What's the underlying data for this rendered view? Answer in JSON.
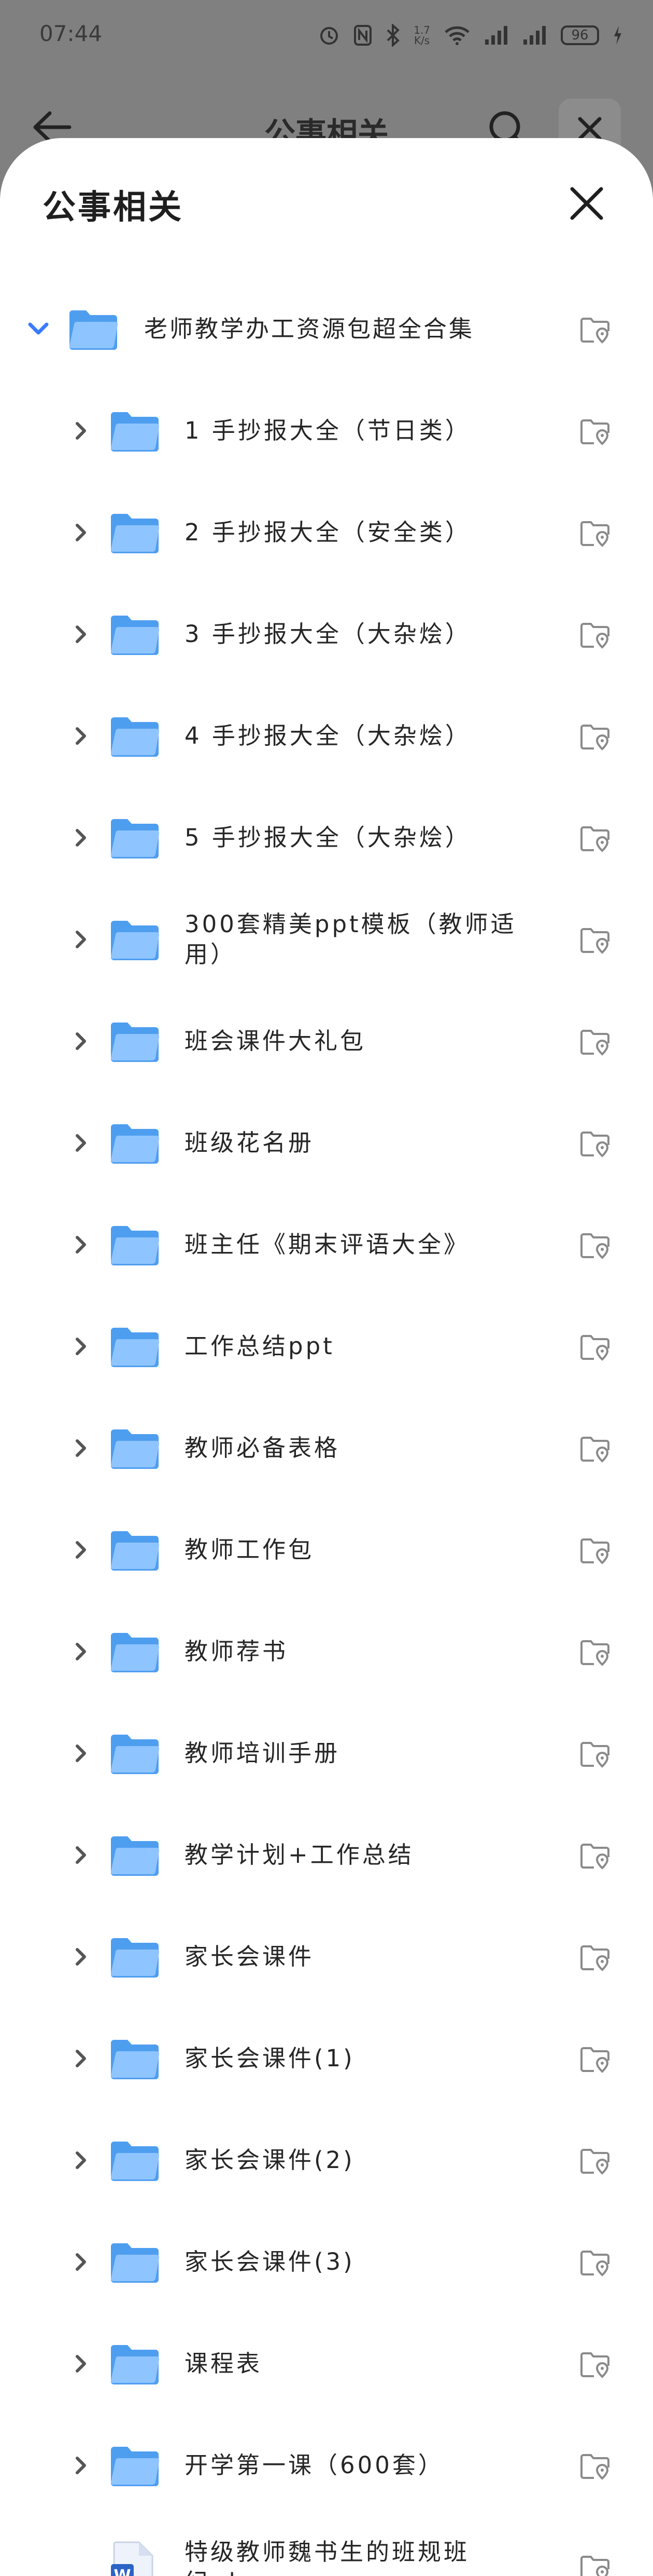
{
  "status_bar": {
    "time": "07:44",
    "net_speed_top": "1.7",
    "net_speed_bottom": "K/s",
    "battery": "96"
  },
  "background_bar": {
    "title": "公事相关"
  },
  "sheet": {
    "title": "公事相关",
    "root": {
      "label": "老师教学办工资源包超全合集",
      "expanded": true
    },
    "items": [
      {
        "label": "1 手抄报大全（节日类）",
        "type": "folder"
      },
      {
        "label": "2 手抄报大全（安全类）",
        "type": "folder"
      },
      {
        "label": "3 手抄报大全（大杂烩）",
        "type": "folder"
      },
      {
        "label": "4 手抄报大全（大杂烩）",
        "type": "folder"
      },
      {
        "label": "5 手抄报大全（大杂烩）",
        "type": "folder"
      },
      {
        "label": "300套精美ppt模板（教师适用）",
        "type": "folder"
      },
      {
        "label": "班会课件大礼包",
        "type": "folder"
      },
      {
        "label": "班级花名册",
        "type": "folder"
      },
      {
        "label": "班主任《期末评语大全》",
        "type": "folder"
      },
      {
        "label": "工作总结ppt",
        "type": "folder"
      },
      {
        "label": "教师必备表格",
        "type": "folder"
      },
      {
        "label": "教师工作包",
        "type": "folder"
      },
      {
        "label": "教师荐书",
        "type": "folder"
      },
      {
        "label": "教师培训手册",
        "type": "folder"
      },
      {
        "label": "教学计划+工作总结",
        "type": "folder"
      },
      {
        "label": "家长会课件",
        "type": "folder"
      },
      {
        "label": "家长会课件(1)",
        "type": "folder"
      },
      {
        "label": "家长会课件(2)",
        "type": "folder"
      },
      {
        "label": "家长会课件(3)",
        "type": "folder"
      },
      {
        "label": "课程表",
        "type": "folder"
      },
      {
        "label": "开学第一课（600套）",
        "type": "folder"
      },
      {
        "label": "特级教师魏书生的班规班纪.docx",
        "type": "docx"
      }
    ]
  },
  "colors": {
    "folder_back": "#4e9ef0",
    "folder_front": "#8ec4ff",
    "expand_arrow": "#3a7bff",
    "collapse_arrow": "#555555",
    "location_icon": "#8a8a8a",
    "word_icon": "#2b63c6"
  },
  "icons": {
    "back": "back-arrow-icon",
    "search": "search-icon",
    "close": "close-icon",
    "folder": "folder-icon",
    "expand": "chevron-down-icon",
    "collapse": "chevron-right-icon",
    "location": "folder-location-icon",
    "word": "word-doc-icon"
  }
}
